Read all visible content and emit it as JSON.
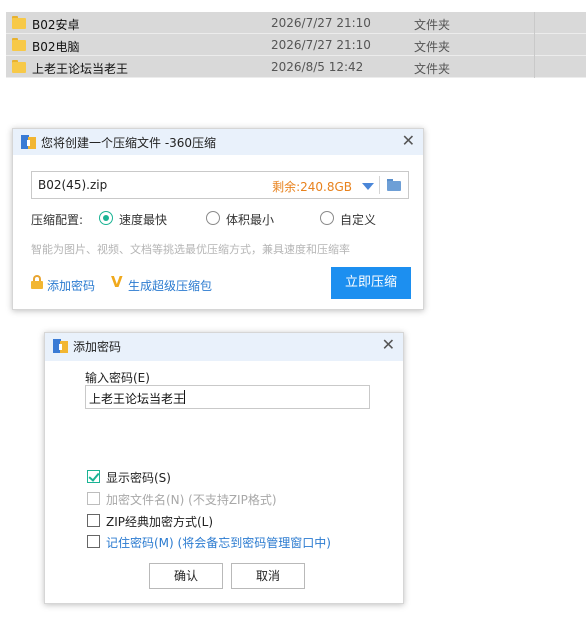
{
  "file_list": {
    "rows": [
      {
        "name": "B02安卓",
        "date": "2026/7/27 21:10",
        "type": "文件夹"
      },
      {
        "name": "B02电脑",
        "date": "2026/7/27 21:10",
        "type": "文件夹"
      },
      {
        "name": "上老王论坛当老王",
        "date": "2026/8/5 12:42",
        "type": "文件夹"
      }
    ]
  },
  "compress_dialog": {
    "title": "您将创建一个压缩文件 -360压缩",
    "filename": "B02(45).zip",
    "free_space": "剩余:240.8GB",
    "config_label": "压缩配置:",
    "options": [
      "速度最快",
      "体积最小",
      "自定义"
    ],
    "selected_option": "速度最快",
    "hint": "智能为图片、视频、文档等挑选最优压缩方式，兼具速度和压缩率",
    "add_password_link": "添加密码",
    "super_pack_link": "生成超级压缩包",
    "compress_button": "立即压缩"
  },
  "password_dialog": {
    "title": "添加密码",
    "input_label": "输入密码(E)",
    "password_value": "上老王论坛当老王",
    "checkboxes": [
      {
        "label": "显示密码(S)",
        "checked": true
      },
      {
        "label": "加密文件名(N) (不支持ZIP格式)",
        "checked": false,
        "disabled": true
      },
      {
        "label": "ZIP经典加密方式(L)",
        "checked": false
      },
      {
        "label": "记住密码(M) (将会备忘到密码管理窗口中)",
        "checked": false
      }
    ],
    "ok_button": "确认",
    "cancel_button": "取消"
  },
  "colors": {
    "accent": "#1c8ff0",
    "link": "#2b7bd0",
    "space_text": "#e8821d",
    "check_green": "#1ab394"
  }
}
